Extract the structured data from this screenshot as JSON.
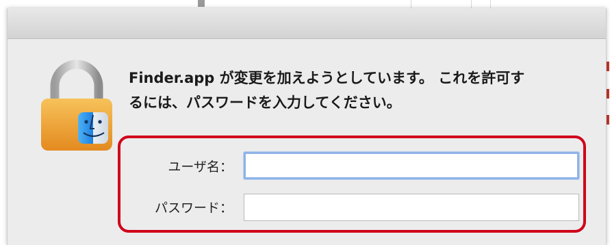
{
  "dialog": {
    "message_line1": "Finder.app が変更を加えようとしています。 これを許可す",
    "message_line2": "るには、パスワードを入力してください。",
    "username_label": "ユーザ名：",
    "username_value": "",
    "password_label": "パスワード：",
    "password_value": ""
  },
  "icons": {
    "lock": "lock-finder-icon"
  },
  "colors": {
    "highlight": "#d0021b",
    "focus_ring": "#8fb3e8",
    "dialog_bg": "#ececec"
  }
}
